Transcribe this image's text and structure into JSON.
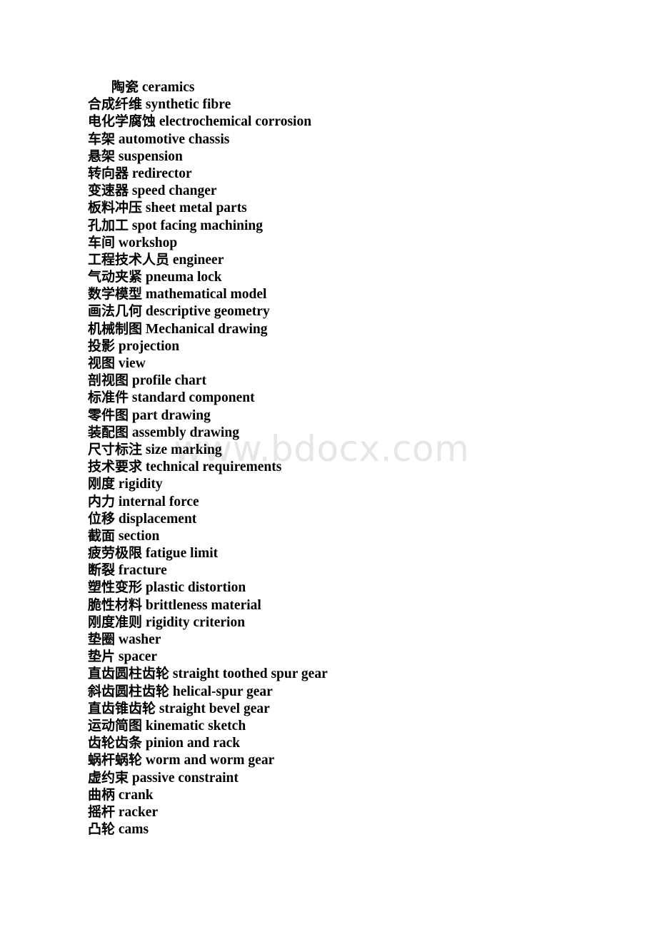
{
  "document": {
    "type": "bilingual-glossary",
    "language_pair": "Chinese-English",
    "watermark": "www.bdocx.com",
    "text_color": "#000000",
    "watermark_color": "#e6e6e6",
    "background_color": "#ffffff"
  },
  "entries": [
    {
      "zh": "陶瓷",
      "en": "ceramics",
      "indent": true
    },
    {
      "zh": "合成纤维",
      "en": "synthetic fibre",
      "indent": false
    },
    {
      "zh": "电化学腐蚀",
      "en": "electrochemical corrosion",
      "indent": false
    },
    {
      "zh": "车架",
      "en": "automotive chassis",
      "indent": false
    },
    {
      "zh": "悬架",
      "en": "suspension",
      "indent": false
    },
    {
      "zh": "转向器",
      "en": "redirector",
      "indent": false
    },
    {
      "zh": "变速器",
      "en": "speed changer",
      "indent": false
    },
    {
      "zh": "板料冲压",
      "en": "sheet metal parts",
      "indent": false
    },
    {
      "zh": "孔加工",
      "en": "spot facing machining",
      "indent": false
    },
    {
      "zh": "车间",
      "en": "workshop",
      "indent": false
    },
    {
      "zh": "工程技术人员",
      "en": "engineer",
      "indent": false
    },
    {
      "zh": "气动夹紧",
      "en": "pneuma lock",
      "indent": false
    },
    {
      "zh": "数学模型",
      "en": "mathematical model",
      "indent": false
    },
    {
      "zh": "画法几何",
      "en": "descriptive geometry",
      "indent": false
    },
    {
      "zh": "机械制图",
      "en": "Mechanical drawing",
      "indent": false
    },
    {
      "zh": "投影",
      "en": "projection",
      "indent": false
    },
    {
      "zh": "视图",
      "en": "view",
      "indent": false
    },
    {
      "zh": "剖视图",
      "en": "profile chart",
      "indent": false
    },
    {
      "zh": "标准件",
      "en": "standard component",
      "indent": false
    },
    {
      "zh": "零件图",
      "en": "part drawing",
      "indent": false
    },
    {
      "zh": "装配图",
      "en": "assembly drawing",
      "indent": false
    },
    {
      "zh": "尺寸标注",
      "en": "size marking",
      "indent": false
    },
    {
      "zh": "技术要求",
      "en": "technical requirements",
      "indent": false
    },
    {
      "zh": "刚度",
      "en": "rigidity",
      "indent": false
    },
    {
      "zh": "内力",
      "en": "internal force",
      "indent": false
    },
    {
      "zh": "位移",
      "en": "displacement",
      "indent": false
    },
    {
      "zh": "截面",
      "en": "section",
      "indent": false
    },
    {
      "zh": "疲劳极限",
      "en": "fatigue limit",
      "indent": false
    },
    {
      "zh": "断裂",
      "en": "fracture",
      "indent": false
    },
    {
      "zh": "塑性变形",
      "en": "plastic distortion",
      "indent": false
    },
    {
      "zh": "脆性材料",
      "en": "brittleness material",
      "indent": false
    },
    {
      "zh": "刚度准则",
      "en": "rigidity criterion",
      "indent": false
    },
    {
      "zh": "垫圈",
      "en": "washer",
      "indent": false
    },
    {
      "zh": "垫片",
      "en": "spacer",
      "indent": false
    },
    {
      "zh": "直齿圆柱齿轮",
      "en": "straight toothed spur gear",
      "indent": false
    },
    {
      "zh": "斜齿圆柱齿轮",
      "en": "helical-spur gear",
      "indent": false
    },
    {
      "zh": "直齿锥齿轮",
      "en": "straight bevel gear",
      "indent": false
    },
    {
      "zh": "运动简图",
      "en": "kinematic sketch",
      "indent": false
    },
    {
      "zh": "齿轮齿条",
      "en": "pinion and rack",
      "indent": false
    },
    {
      "zh": "蜗杆蜗轮",
      "en": "worm and worm gear",
      "indent": false
    },
    {
      "zh": "虚约束",
      "en": "passive constraint",
      "indent": false
    },
    {
      "zh": "曲柄",
      "en": "crank",
      "indent": false
    },
    {
      "zh": "摇杆",
      "en": "racker",
      "indent": false
    },
    {
      "zh": "凸轮",
      "en": "cams",
      "indent": false
    }
  ]
}
